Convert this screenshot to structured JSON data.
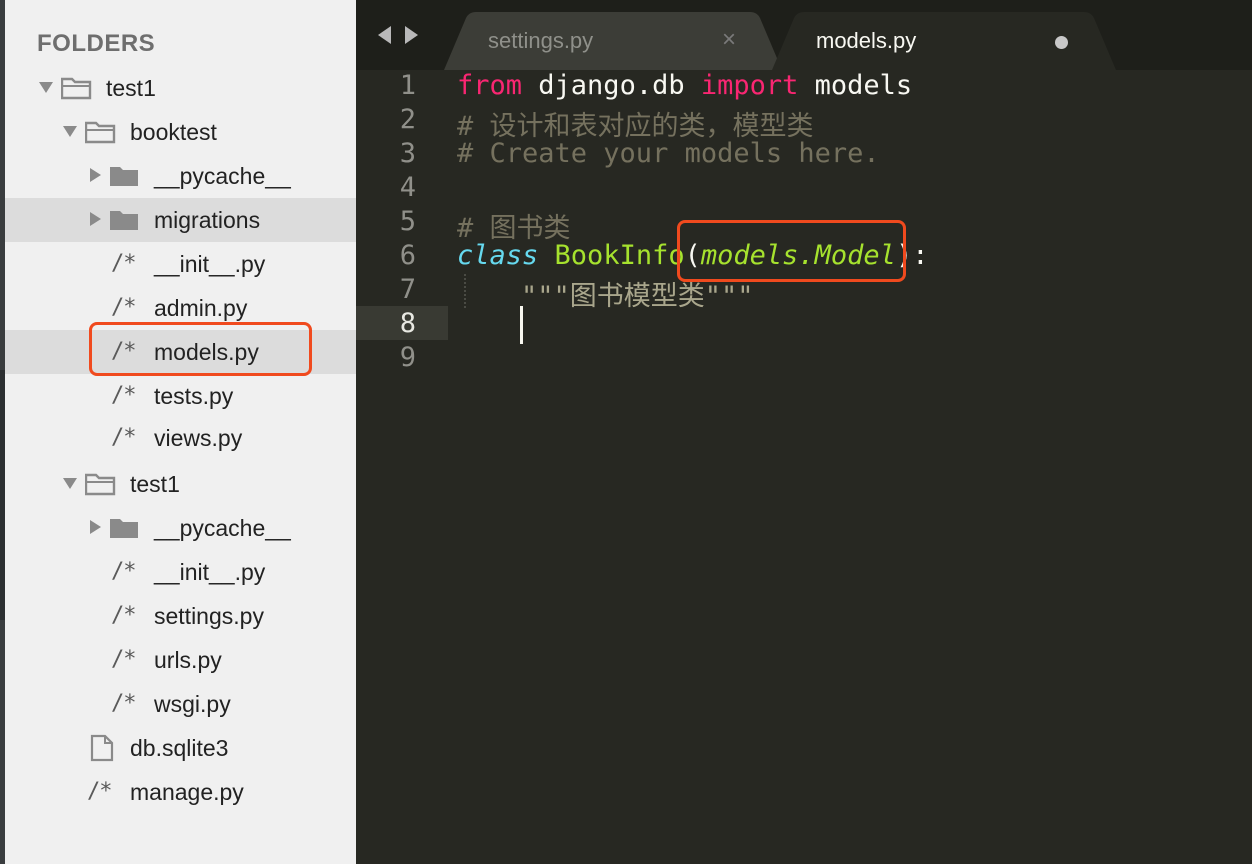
{
  "sidebar": {
    "title": "FOLDERS",
    "rows": [
      {
        "label": "test1"
      },
      {
        "label": "booktest"
      },
      {
        "label": "__pycache__"
      },
      {
        "label": "migrations"
      },
      {
        "label": "__init__.py",
        "icon_text": "/*"
      },
      {
        "label": "admin.py",
        "icon_text": "/*"
      },
      {
        "label": "models.py",
        "icon_text": "/*"
      },
      {
        "label": "tests.py",
        "icon_text": "/*"
      },
      {
        "label": "views.py",
        "icon_text": "/*"
      },
      {
        "label": "test1"
      },
      {
        "label": "__pycache__"
      },
      {
        "label": "__init__.py",
        "icon_text": "/*"
      },
      {
        "label": "settings.py",
        "icon_text": "/*"
      },
      {
        "label": "urls.py",
        "icon_text": "/*"
      },
      {
        "label": "wsgi.py",
        "icon_text": "/*"
      },
      {
        "label": "db.sqlite3"
      },
      {
        "label": "manage.py",
        "icon_text": "/*"
      }
    ]
  },
  "tabs": [
    {
      "label": "settings.py",
      "close": "×"
    },
    {
      "label": "models.py"
    }
  ],
  "editor": {
    "line_numbers": [
      "1",
      "2",
      "3",
      "4",
      "5",
      "6",
      "7",
      "8",
      "9"
    ],
    "lines": {
      "l1": {
        "kw_from": "from",
        "mod": " django.db ",
        "kw_import": "import",
        "name": " models"
      },
      "l2": {
        "comment": "# 设计和表对应的类，模型类"
      },
      "l3": {
        "comment": "# Create your models here."
      },
      "l5": {
        "comment": "# 图书类"
      },
      "l6": {
        "kw_class": "class",
        "space": " ",
        "class_name": "BookInfo",
        "open_paren": "(",
        "base": "models.Model",
        "close": "):"
      },
      "l7": {
        "docstring": "\"\"\"图书模型类\"\"\""
      }
    }
  },
  "colors": {
    "keyword": "#f92672",
    "comment": "#75715e",
    "storage": "#66d9ef",
    "entity": "#a6e22e",
    "highlight_box": "#f04a1e"
  }
}
